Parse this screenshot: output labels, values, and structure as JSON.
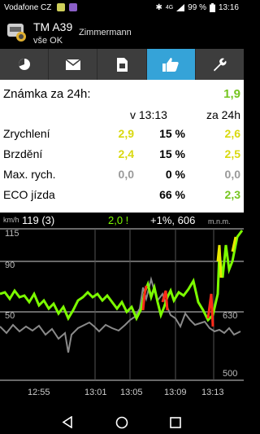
{
  "status": {
    "carrier": "Vodafone CZ",
    "network": "4G",
    "battery": "99 %",
    "time": "13:16",
    "icons": [
      "phone-icon",
      "viber-icon",
      "bluetooth-icon",
      "signal-icon",
      "battery-icon"
    ]
  },
  "header": {
    "title": "TM A39",
    "subtitle": "vše OK",
    "user": "Zimmermann",
    "logo_icon": "car-logo-icon"
  },
  "tabs": [
    {
      "name": "pie-chart-icon",
      "active": false
    },
    {
      "name": "mail-icon",
      "active": false
    },
    {
      "name": "sim-card-icon",
      "active": false
    },
    {
      "name": "thumbs-up-icon",
      "active": true
    },
    {
      "name": "wrench-icon",
      "active": false
    }
  ],
  "summary": {
    "label": "Známka za 24h:",
    "value": "1,9"
  },
  "columns": {
    "current": "v 13:13",
    "daily": "za 24h"
  },
  "metrics": [
    {
      "label": "Zrychlení",
      "value": "2,9",
      "percent": "15 %",
      "daily": "2,6"
    },
    {
      "label": "Brzdění",
      "value": "2,4",
      "percent": "15 %",
      "daily": "2,5"
    },
    {
      "label": "Max. rych.",
      "value": "0,0",
      "percent": "0 %",
      "daily": "0,0"
    },
    {
      "label": "ECO jízda",
      "value": "",
      "percent": "66 %",
      "daily": "2,3"
    }
  ],
  "chart_header": {
    "unit": "km/h",
    "speed": "119 (3)",
    "score": "2,0 !",
    "change": "+1%, 606",
    "alt_unit": "m.n.m."
  },
  "chart_data": {
    "type": "line",
    "y_labels_left": [
      "115",
      "90",
      "50"
    ],
    "y_labels_right": [
      "630",
      "500"
    ],
    "x_ticks": [
      "12:55",
      "13:01",
      "13:05",
      "13:09",
      "13:13"
    ],
    "series": [],
    "colors": {
      "score": "#7cfc00",
      "bad": "#ff2a1a",
      "warn": "#e8e800",
      "altitude": "#8a8a8a",
      "speed": "#b0b0b0"
    }
  },
  "nav": [
    "back-icon",
    "home-icon",
    "recents-icon"
  ]
}
